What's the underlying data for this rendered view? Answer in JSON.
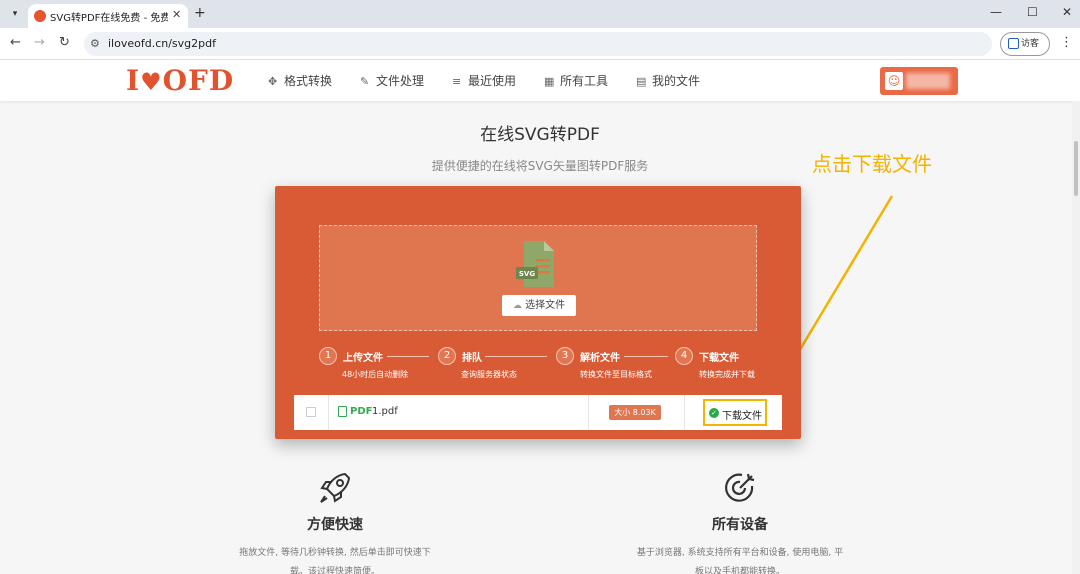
{
  "browser": {
    "tab_title": "SVG转PDF在线免费 - 免费SVG",
    "url": "iloveofd.cn/svg2pdf",
    "guest_label": "访客"
  },
  "site": {
    "logo": "I OFD",
    "logo_left": "I",
    "logo_right": "OFD",
    "nav": [
      {
        "label": "格式转换",
        "icon": "puzzle-icon"
      },
      {
        "label": "文件处理",
        "icon": "file-edit-icon"
      },
      {
        "label": "最近使用",
        "icon": "recent-icon"
      },
      {
        "label": "所有工具",
        "icon": "grid-icon"
      },
      {
        "label": "我的文件",
        "icon": "folder-doc-icon"
      }
    ]
  },
  "main": {
    "title": "在线SVG转PDF",
    "subtitle": "提供便捷的在线将SVG矢量图转PDF服务"
  },
  "annotation": {
    "text": "点击下载文件",
    "color": "#f3b300"
  },
  "upload": {
    "icon_label": "SVG",
    "choose_button": "选择文件"
  },
  "steps": [
    {
      "num": "1",
      "title": "上传文件",
      "desc": "48小时后自动删除"
    },
    {
      "num": "2",
      "title": "排队",
      "desc": "查询服务器状态"
    },
    {
      "num": "3",
      "title": "解析文件",
      "desc": "转换文件至目标格式"
    },
    {
      "num": "4",
      "title": "下载文件",
      "desc": "转换完成并下载"
    }
  ],
  "file": {
    "type_tag": "PDF",
    "name": "1.pdf",
    "size": "大小 8.03K",
    "download_label": "下载文件"
  },
  "features": [
    {
      "title": "方便快速",
      "desc_line1": "拖放文件, 等待几秒钟转换, 然后单击即可快速下",
      "desc_line2": "载。该过程快速简便。"
    },
    {
      "title": "所有设备",
      "desc_line1": "基于浏览器, 系统支持所有平台和设备, 使用电脑, 平",
      "desc_line2": "板以及手机都能转换。"
    }
  ],
  "colors": {
    "brand": "#e0532e",
    "panel": "#d95b36",
    "success": "#2aa74a"
  }
}
